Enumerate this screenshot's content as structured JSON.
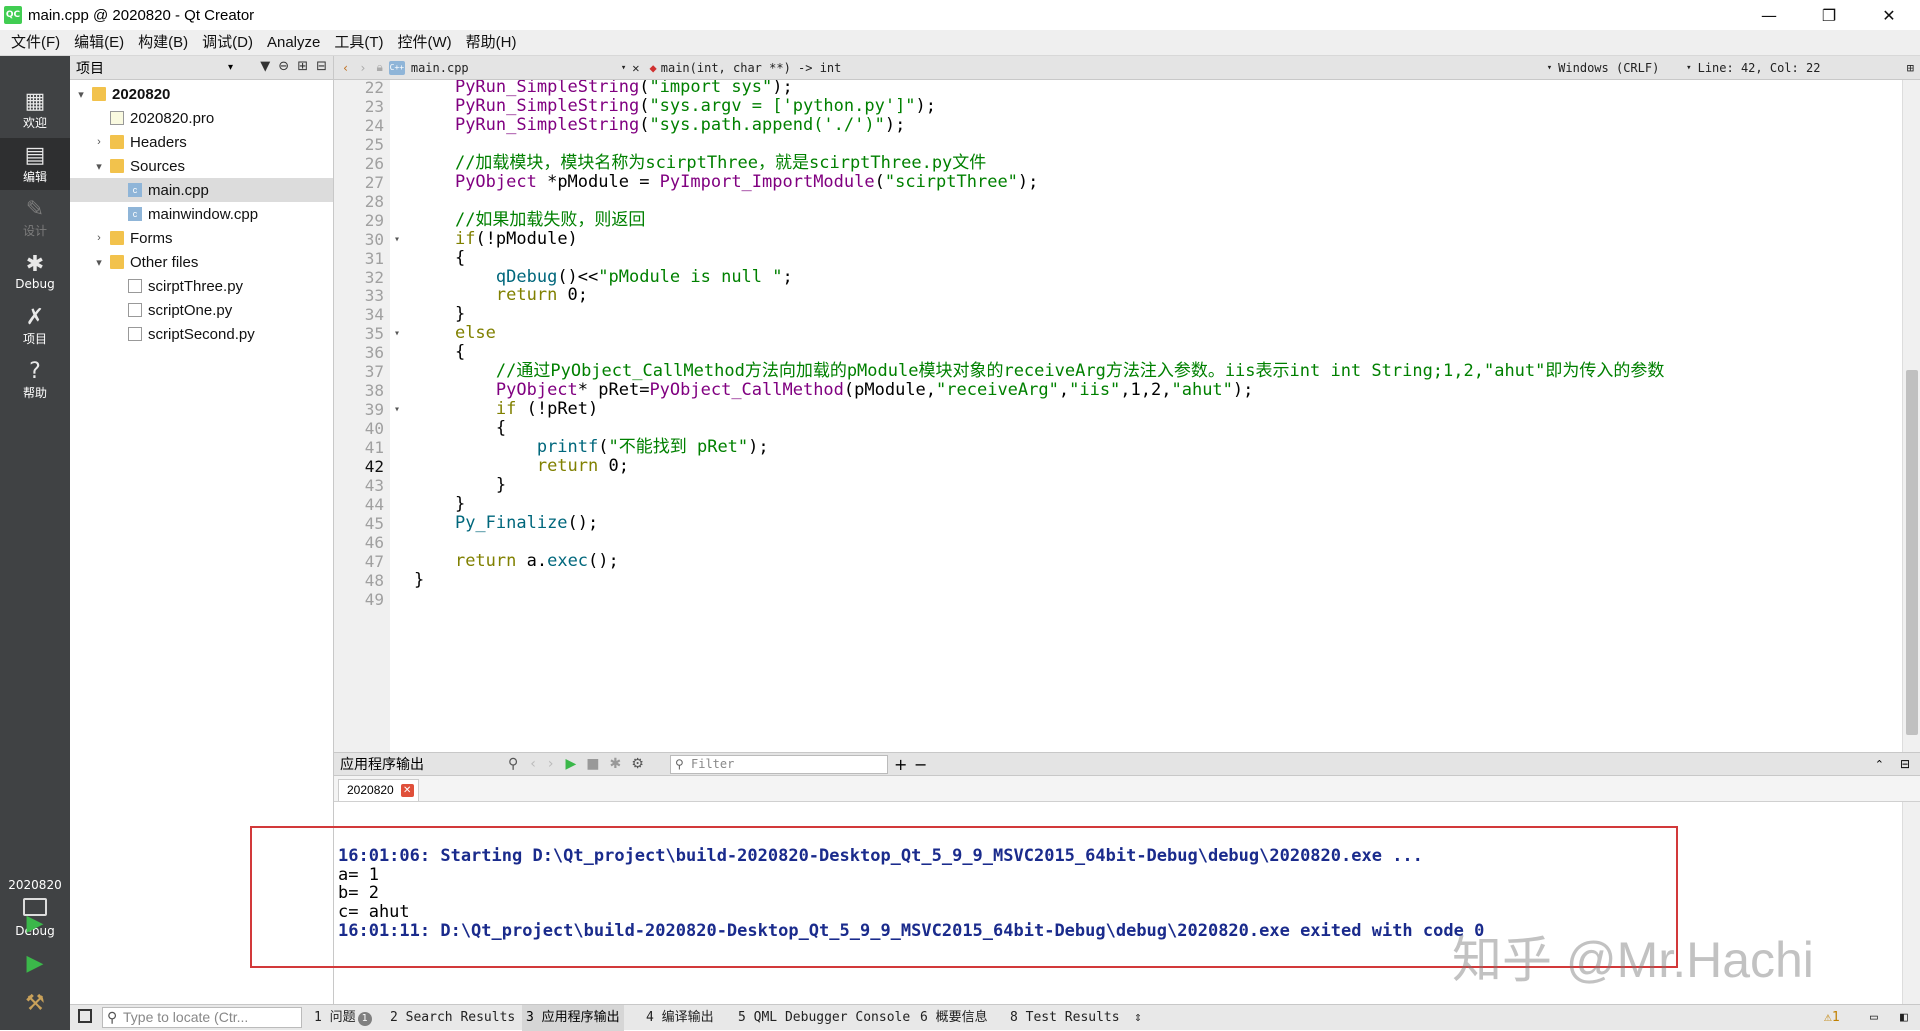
{
  "window": {
    "title": "main.cpp @ 2020820 - Qt Creator",
    "app_icon": "QC",
    "minimize": "—",
    "maximize": "❐",
    "close": "✕"
  },
  "menu": [
    "文件(F)",
    "编辑(E)",
    "构建(B)",
    "调试(D)",
    "Analyze",
    "工具(T)",
    "控件(W)",
    "帮助(H)"
  ],
  "modes": [
    {
      "label": "欢迎",
      "icon": "grid-icon",
      "glyph": "▦"
    },
    {
      "label": "编辑",
      "icon": "edit-icon",
      "glyph": "▤"
    },
    {
      "label": "设计",
      "icon": "design-icon",
      "glyph": "✎"
    },
    {
      "label": "Debug",
      "icon": "bug-icon",
      "glyph": "✱"
    },
    {
      "label": "项目",
      "icon": "wrench-icon",
      "glyph": "✗"
    },
    {
      "label": "帮助",
      "icon": "help-icon",
      "glyph": "?"
    }
  ],
  "kit": {
    "project": "2020820",
    "config": "Debug"
  },
  "project_pane": {
    "title": "项目",
    "tree": [
      {
        "label": "2020820",
        "level": 0,
        "arrow": "▾",
        "icon": "folder",
        "bold": true
      },
      {
        "label": "2020820.pro",
        "level": 1,
        "arrow": "",
        "icon": "pro"
      },
      {
        "label": "Headers",
        "level": 1,
        "arrow": "›",
        "icon": "folder"
      },
      {
        "label": "Sources",
        "level": 1,
        "arrow": "▾",
        "icon": "folder"
      },
      {
        "label": "main.cpp",
        "level": 2,
        "arrow": "",
        "icon": "cpp",
        "selected": true
      },
      {
        "label": "mainwindow.cpp",
        "level": 2,
        "arrow": "",
        "icon": "cpp"
      },
      {
        "label": "Forms",
        "level": 1,
        "arrow": "›",
        "icon": "folder"
      },
      {
        "label": "Other files",
        "level": 1,
        "arrow": "▾",
        "icon": "folder"
      },
      {
        "label": "scirptThree.py",
        "level": 2,
        "arrow": "",
        "icon": "file"
      },
      {
        "label": "scriptOne.py",
        "level": 2,
        "arrow": "",
        "icon": "file"
      },
      {
        "label": "scriptSecond.py",
        "level": 2,
        "arrow": "",
        "icon": "file"
      }
    ]
  },
  "editor_bar": {
    "file": "main.cpp",
    "symbol": "main(int, char **) -> int",
    "line_ending": "Windows (CRLF)",
    "position": "Line: 42, Col: 22"
  },
  "editor": {
    "current_line": 42,
    "lines": [
      {
        "n": "22",
        "fold": "",
        "tokens": [
          [
            "    ",
            "def"
          ],
          [
            "PyRun_SimpleString",
            "type"
          ],
          [
            "(",
            "def"
          ],
          [
            "\"import sys\"",
            "str"
          ],
          [
            ");",
            "def"
          ]
        ]
      },
      {
        "n": "23",
        "fold": "",
        "tokens": [
          [
            "    ",
            "def"
          ],
          [
            "PyRun_SimpleString",
            "type"
          ],
          [
            "(",
            "def"
          ],
          [
            "\"sys.argv = ['python.py']\"",
            "str"
          ],
          [
            ");",
            "def"
          ]
        ]
      },
      {
        "n": "24",
        "fold": "",
        "tokens": [
          [
            "    ",
            "def"
          ],
          [
            "PyRun_SimpleString",
            "type"
          ],
          [
            "(",
            "def"
          ],
          [
            "\"sys.path.append('./')\"",
            "str"
          ],
          [
            ");",
            "def"
          ]
        ]
      },
      {
        "n": "25",
        "fold": "",
        "tokens": []
      },
      {
        "n": "26",
        "fold": "",
        "tokens": [
          [
            "    ",
            "def"
          ],
          [
            "//加载模块，模块名称为scirptThree，就是scirptThree.py文件",
            "cmt"
          ]
        ]
      },
      {
        "n": "27",
        "fold": "",
        "tokens": [
          [
            "    ",
            "def"
          ],
          [
            "PyObject",
            "type"
          ],
          [
            " *pModule = ",
            "def"
          ],
          [
            "PyImport_ImportModule",
            "type"
          ],
          [
            "(",
            "def"
          ],
          [
            "\"scirptThree\"",
            "str"
          ],
          [
            ");",
            "def"
          ]
        ]
      },
      {
        "n": "28",
        "fold": "",
        "tokens": []
      },
      {
        "n": "29",
        "fold": "",
        "tokens": [
          [
            "    ",
            "def"
          ],
          [
            "//如果加载失败，则返回",
            "cmt"
          ]
        ]
      },
      {
        "n": "30",
        "fold": "▾",
        "tokens": [
          [
            "    ",
            "def"
          ],
          [
            "if",
            "kw"
          ],
          [
            "(!pModule)",
            "def"
          ]
        ]
      },
      {
        "n": "31",
        "fold": "",
        "tokens": [
          [
            "    {",
            "def"
          ]
        ]
      },
      {
        "n": "32",
        "fold": "",
        "tokens": [
          [
            "        ",
            "def"
          ],
          [
            "qDebug",
            "fn"
          ],
          [
            "()<<",
            "def"
          ],
          [
            "\"pModule is null \"",
            "str"
          ],
          [
            ";",
            "def"
          ]
        ]
      },
      {
        "n": "33",
        "fold": "",
        "tokens": [
          [
            "        ",
            "def"
          ],
          [
            "return",
            "kw"
          ],
          [
            " 0;",
            "def"
          ]
        ]
      },
      {
        "n": "34",
        "fold": "",
        "tokens": [
          [
            "    }",
            "def"
          ]
        ]
      },
      {
        "n": "35",
        "fold": "▾",
        "tokens": [
          [
            "    ",
            "def"
          ],
          [
            "else",
            "kw"
          ]
        ]
      },
      {
        "n": "36",
        "fold": "",
        "tokens": [
          [
            "    {",
            "def"
          ]
        ]
      },
      {
        "n": "37",
        "fold": "",
        "tokens": [
          [
            "        ",
            "def"
          ],
          [
            "//通过PyObject_CallMethod方法向加载的pModule模块对象的receiveArg方法注入参数。iis表示int int String;1,2,\"ahut\"即为传入的参数",
            "cmt"
          ]
        ]
      },
      {
        "n": "38",
        "fold": "",
        "tokens": [
          [
            "        ",
            "def"
          ],
          [
            "PyObject",
            "type"
          ],
          [
            "* pRet=",
            "def"
          ],
          [
            "PyObject_CallMethod",
            "type"
          ],
          [
            "(pModule,",
            "def"
          ],
          [
            "\"receiveArg\"",
            "str"
          ],
          [
            ",",
            "def"
          ],
          [
            "\"iis\"",
            "str"
          ],
          [
            ",1,2,",
            "def"
          ],
          [
            "\"ahut\"",
            "str"
          ],
          [
            ");",
            "def"
          ]
        ]
      },
      {
        "n": "39",
        "fold": "▾",
        "tokens": [
          [
            "        ",
            "def"
          ],
          [
            "if",
            "kw"
          ],
          [
            " (!pRet)",
            "def"
          ]
        ]
      },
      {
        "n": "40",
        "fold": "",
        "tokens": [
          [
            "        {",
            "def"
          ]
        ]
      },
      {
        "n": "41",
        "fold": "",
        "tokens": [
          [
            "            ",
            "def"
          ],
          [
            "printf",
            "fn"
          ],
          [
            "(",
            "def"
          ],
          [
            "\"不能找到 pRet\"",
            "str"
          ],
          [
            ");",
            "def"
          ]
        ]
      },
      {
        "n": "42",
        "fold": "",
        "tokens": [
          [
            "            ",
            "def"
          ],
          [
            "return",
            "kw"
          ],
          [
            " 0;",
            "def"
          ]
        ]
      },
      {
        "n": "43",
        "fold": "",
        "tokens": [
          [
            "        }",
            "def"
          ]
        ]
      },
      {
        "n": "44",
        "fold": "",
        "tokens": [
          [
            "    }",
            "def"
          ]
        ]
      },
      {
        "n": "45",
        "fold": "",
        "tokens": [
          [
            "    ",
            "def"
          ],
          [
            "Py_Finalize",
            "fn"
          ],
          [
            "();",
            "def"
          ]
        ]
      },
      {
        "n": "46",
        "fold": "",
        "tokens": []
      },
      {
        "n": "47",
        "fold": "",
        "tokens": [
          [
            "    ",
            "def"
          ],
          [
            "return",
            "kw"
          ],
          [
            " a.",
            "def"
          ],
          [
            "exec",
            "fn"
          ],
          [
            "();",
            "def"
          ]
        ]
      },
      {
        "n": "48",
        "fold": "",
        "tokens": [
          [
            "}",
            "def"
          ]
        ]
      },
      {
        "n": "49",
        "fold": "",
        "tokens": []
      }
    ]
  },
  "output_pane": {
    "title": "应用程序输出",
    "filter_placeholder": "Filter",
    "tab": "2020820",
    "lines": [
      {
        "text": "",
        "kind": "plain"
      },
      {
        "text": "16:01:06: Starting D:\\Qt_project\\build-2020820-Desktop_Qt_5_9_9_MSVC2015_64bit-Debug\\debug\\2020820.exe ...",
        "kind": "info"
      },
      {
        "text": "a= 1",
        "kind": "plain"
      },
      {
        "text": "b= 2",
        "kind": "plain"
      },
      {
        "text": "c= ahut",
        "kind": "plain"
      },
      {
        "text": "16:01:11: D:\\Qt_project\\build-2020820-Desktop_Qt_5_9_9_MSVC2015_64bit-Debug\\debug\\2020820.exe exited with code 0",
        "kind": "info"
      }
    ]
  },
  "watermark": "知乎 @Mr.Hachi",
  "statusbar": {
    "locate_placeholder": "Type to locate (Ctr...",
    "panes": [
      {
        "label": "1 问题",
        "badge": "1"
      },
      {
        "label": "2 Search Results"
      },
      {
        "label": "3 应用程序输出",
        "active": true
      },
      {
        "label": "4 编译输出"
      },
      {
        "label": "5 QML Debugger Console"
      },
      {
        "label": "6 概要信息"
      },
      {
        "label": "8 Test Results"
      }
    ],
    "warning": "⚠1"
  },
  "colors": {
    "accent": "#41cd52",
    "modebar": "#404244",
    "highlight_box": "#d2393a",
    "output_info": "#1a2b8c"
  }
}
